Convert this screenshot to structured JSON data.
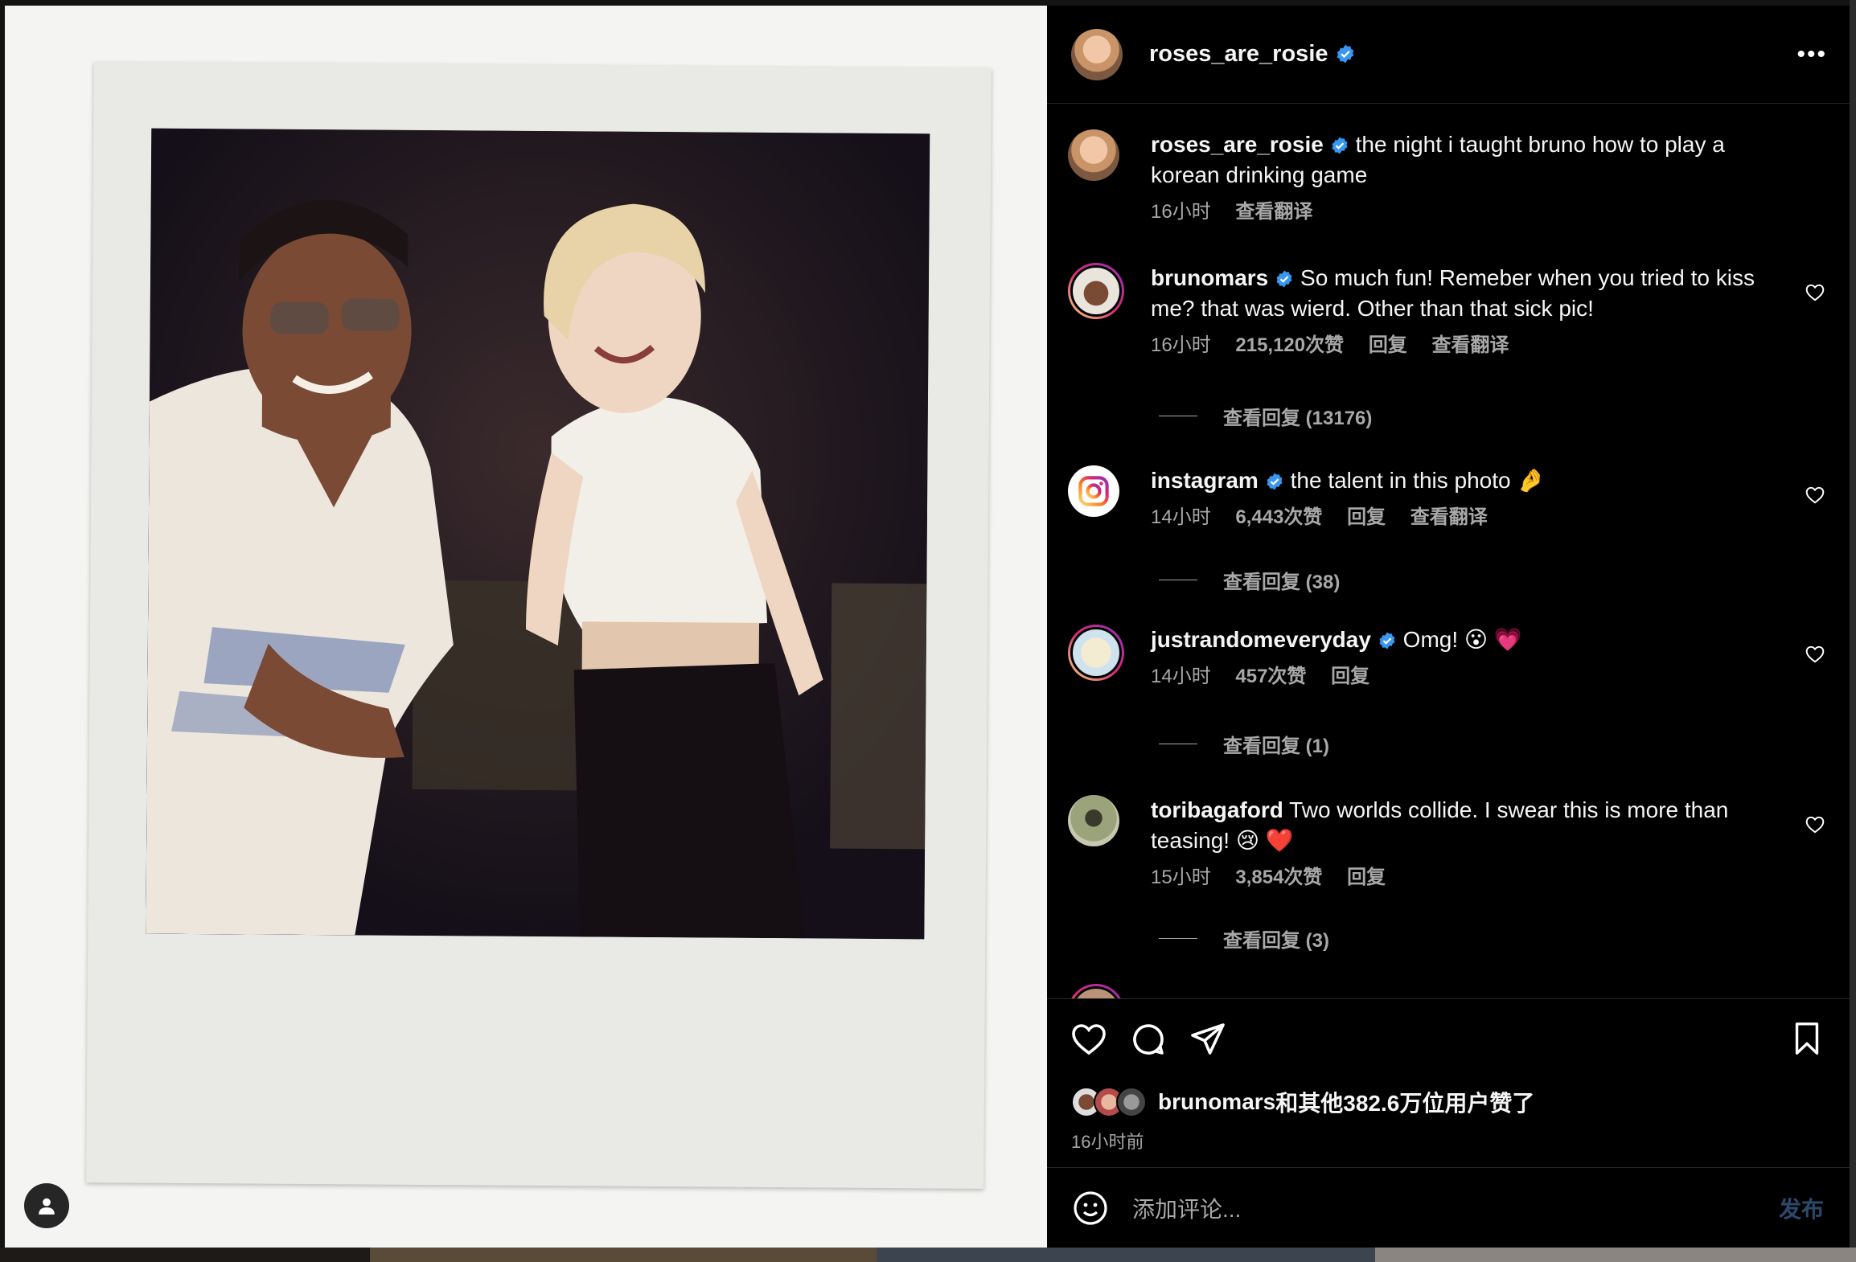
{
  "post": {
    "author": "roses_are_rosie",
    "more_label": "•••",
    "caption_user": "roses_are_rosie",
    "caption_text": "the night i taught bruno how to play a korean drinking game",
    "caption_time": "16小时",
    "caption_translate": "查看翻译"
  },
  "comments": [
    {
      "user": "brunomars",
      "text": "So much fun! Remeber when you tried to kiss me? that was wierd. Other than that sick pic!",
      "time": "16小时",
      "likes": "215,120次赞",
      "reply": "回复",
      "translate": "查看翻译",
      "view_replies": "查看回复 (13176)"
    },
    {
      "user": "instagram",
      "text": "the talent in this photo 🤌",
      "time": "14小时",
      "likes": "6,443次赞",
      "reply": "回复",
      "translate": "查看翻译",
      "view_replies": "查看回复 (38)"
    },
    {
      "user": "justrandomeveryday",
      "text": "Omg! 😮 💗",
      "time": "14小时",
      "likes": "457次赞",
      "reply": "回复",
      "view_replies": "查看回复 (1)"
    },
    {
      "user": "toribagaford",
      "text": "Two worlds collide. I swear this is more than teasing! 😢 ❤️",
      "time": "15小时",
      "likes": "3,854次赞",
      "reply": "回复",
      "view_replies": "查看回复 (3)"
    }
  ],
  "likes_summary": {
    "user": "brunomars",
    "text": "和其他382.6万位用户赞了"
  },
  "posted_ago": "16小时前",
  "composer": {
    "placeholder": "添加评论...",
    "post_label": "发布"
  },
  "colors": {
    "verified": "#3897f0",
    "link_disabled": "#2b4a6b",
    "muted": "#a8a8a8"
  }
}
